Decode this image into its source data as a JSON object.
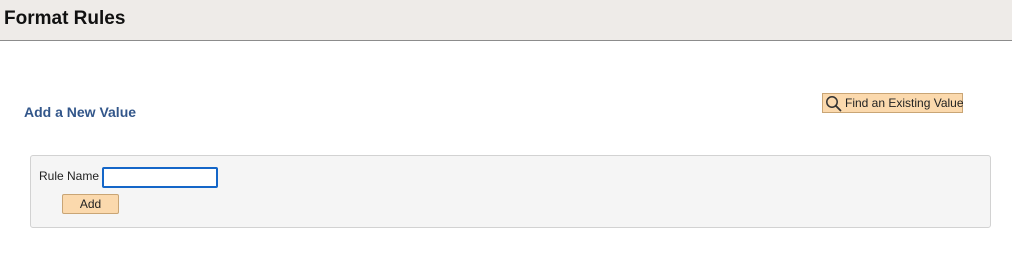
{
  "header": {
    "title": "Format Rules"
  },
  "search": {
    "find_existing_label": "Find an Existing Value",
    "icon": "search-icon"
  },
  "add_section": {
    "heading": "Add a New Value",
    "field_label": "Rule Name",
    "field_value": "",
    "add_label": "Add"
  },
  "colors": {
    "accent_heading": "#32568a",
    "button_bg": "#fbd9ad",
    "input_focus_border": "#1466c8",
    "header_bg": "#eeebe8"
  }
}
